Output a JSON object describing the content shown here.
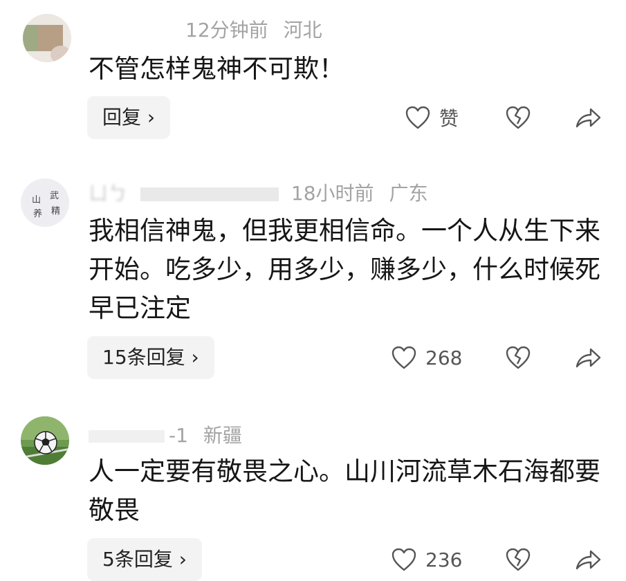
{
  "comments": [
    {
      "time": "12分钟前",
      "location": "河北",
      "text": "不管怎样鬼神不可欺！",
      "reply_label": "回复 ›",
      "like_label": "赞"
    },
    {
      "username_partial": "ㄩㄅ",
      "time": "18小时前",
      "location": "广东",
      "text": "我相信神鬼，但我更相信命。一个人从生下来开始。吃多少，用多少，赚多少，什么时候死早已注定",
      "reply_label": "15条回复 ›",
      "like_label": "268"
    },
    {
      "username_partial": "-1",
      "location": "新疆",
      "text": "人一定要有敬畏之心。山川河流草木石海都要敬畏",
      "reply_label": "5条回复 ›",
      "like_label": "236"
    }
  ],
  "avatar_text": [
    "山",
    "武",
    "养",
    "精"
  ]
}
